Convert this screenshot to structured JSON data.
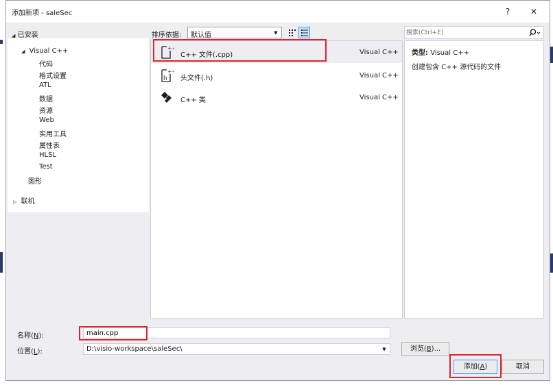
{
  "window": {
    "title": "添加新项 - saleSec",
    "help_label": "?",
    "close_label": "✕"
  },
  "left": {
    "installed_label": "已安装",
    "tree": [
      {
        "label": "Visual C++",
        "level": 0,
        "expanded": true,
        "selected": true
      },
      {
        "label": "代码",
        "level": 1
      },
      {
        "label": "格式设置",
        "level": 1
      },
      {
        "label": "ATL",
        "level": 1
      },
      {
        "label": "数据",
        "level": 1
      },
      {
        "label": "资源",
        "level": 1
      },
      {
        "label": "Web",
        "level": 1
      },
      {
        "label": "实用工具",
        "level": 1
      },
      {
        "label": "属性表",
        "level": 1
      },
      {
        "label": "HLSL",
        "level": 1
      },
      {
        "label": "Test",
        "level": 1
      },
      {
        "label": "图形",
        "level": 0
      }
    ],
    "online_label": "联机"
  },
  "toolbar": {
    "sort_label": "排序依据:",
    "sort_value": "默认值"
  },
  "templates": [
    {
      "name": "C++ 文件(.cpp)",
      "type": "Visual C++",
      "icon": "cpp-file-icon",
      "selected": true
    },
    {
      "name": "头文件(.h)",
      "type": "Visual C++",
      "icon": "header-file-icon",
      "selected": false
    },
    {
      "name": "C++ 类",
      "type": "Visual C++",
      "icon": "cpp-class-icon",
      "selected": false
    }
  ],
  "search": {
    "placeholder": "搜索(Ctrl+E)"
  },
  "info": {
    "type_label": "类型:",
    "type_value": "Visual C++",
    "description": "创建包含 C++ 源代码的文件"
  },
  "form": {
    "name_label": "名称(",
    "name_key": "N",
    "name_suffix": "):",
    "name_value": "main.cpp",
    "location_label": "位置(",
    "location_key": "L",
    "location_suffix": "):",
    "location_value": "D:\\visio-workspace\\saleSec\\",
    "browse_label": "浏览(",
    "browse_key": "B",
    "browse_suffix": ")...",
    "add_label": "添加(",
    "add_key": "A",
    "add_suffix": ")",
    "cancel_label": "取消"
  },
  "colors": {
    "highlight_red": "#e0232e",
    "accent_blue": "#3399ff",
    "icon_purple": "#9b4f96"
  }
}
